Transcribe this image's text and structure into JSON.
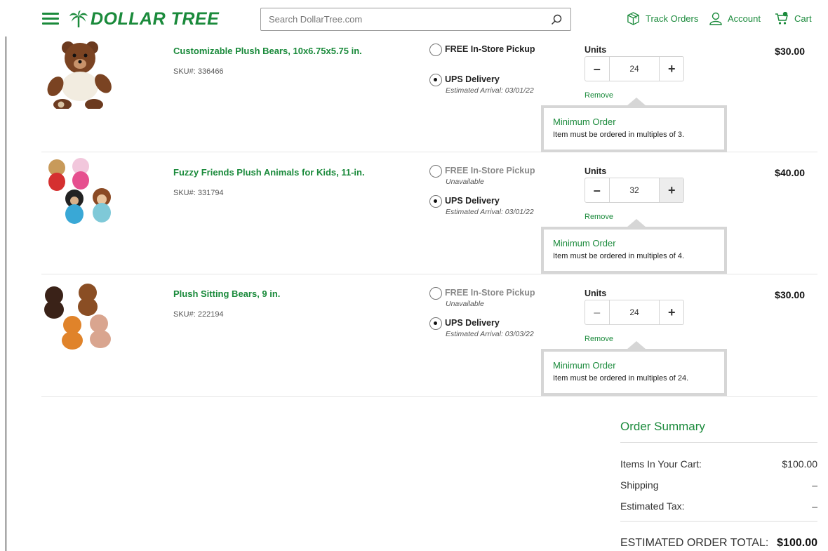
{
  "header": {
    "logo_text": "DOLLAR TREE",
    "search_placeholder": "Search DollarTree.com",
    "nav": {
      "track_orders": "Track Orders",
      "account": "Account",
      "cart": "Cart"
    },
    "brand_color": "#1a8a3b"
  },
  "cart": {
    "items": [
      {
        "name": "Customizable Plush Bears, 10x6.75x5.75 in.",
        "sku": "SKU#: 336466",
        "pickup_label": "FREE In-Store Pickup",
        "pickup_sub": "",
        "delivery_label": "UPS Delivery",
        "delivery_sub": "Estimated Arrival: 03/01/22",
        "units_label": "Units",
        "quantity": "24",
        "remove_label": "Remove",
        "price": "$30.00",
        "tip_title": "Minimum Order",
        "tip_text": "Item must be ordered in multiples of 3."
      },
      {
        "name": "Fuzzy Friends Plush Animals for Kids, 11-in.",
        "sku": "SKU#: 331794",
        "pickup_label": "FREE In-Store Pickup",
        "pickup_sub": "Unavailable",
        "delivery_label": "UPS Delivery",
        "delivery_sub": "Estimated Arrival: 03/01/22",
        "units_label": "Units",
        "quantity": "32",
        "remove_label": "Remove",
        "price": "$40.00",
        "tip_title": "Minimum Order",
        "tip_text": "Item must be ordered in multiples of 4."
      },
      {
        "name": "Plush Sitting Bears, 9 in.",
        "sku": "SKU#: 222194",
        "pickup_label": "FREE In-Store Pickup",
        "pickup_sub": "Unavailable",
        "delivery_label": "UPS Delivery",
        "delivery_sub": "Estimated Arrival: 03/03/22",
        "units_label": "Units",
        "quantity": "24",
        "remove_label": "Remove",
        "price": "$30.00",
        "tip_title": "Minimum Order",
        "tip_text": "Item must be ordered in multiples of 24."
      }
    ]
  },
  "summary": {
    "title": "Order Summary",
    "items_label": "Items In Your Cart:",
    "items_value": "$100.00",
    "shipping_label": "Shipping",
    "shipping_value": "–",
    "tax_label": "Estimated Tax:",
    "tax_value": "–",
    "total_label": "ESTIMATED ORDER TOTAL:",
    "total_value": "$100.00"
  }
}
